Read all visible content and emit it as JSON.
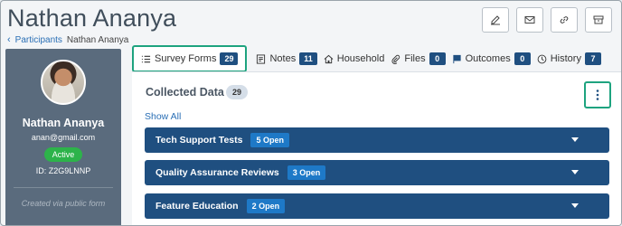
{
  "header": {
    "title": "Nathan Ananya",
    "breadcrumb": {
      "parent": "Participants",
      "current": "Nathan Ananya"
    },
    "actions": [
      {
        "icon": "edit-icon"
      },
      {
        "icon": "mail-icon"
      },
      {
        "icon": "link-icon"
      },
      {
        "icon": "archive-icon"
      }
    ]
  },
  "profile": {
    "name": "Nathan Ananya",
    "email": "anan@gmail.com",
    "status": "Active",
    "status_color": "#2db34a",
    "id_text": "ID: Z2G9LNNP",
    "note": "Created via public form"
  },
  "tabs": [
    {
      "label": "Survey Forms",
      "count": "29",
      "icon": "list-icon",
      "active": true
    },
    {
      "label": "Notes",
      "count": "11",
      "icon": "notes-icon"
    },
    {
      "label": "Household",
      "count": "",
      "icon": "home-icon"
    },
    {
      "label": "Files",
      "count": "0",
      "icon": "paperclip-icon"
    },
    {
      "label": "Outcomes",
      "count": "0",
      "icon": "flag-icon"
    },
    {
      "label": "History",
      "count": "7",
      "icon": "clock-icon"
    }
  ],
  "collected": {
    "title": "Collected Data",
    "count": "29",
    "show_all": "Show All",
    "groups": [
      {
        "title": "Tech Support Tests",
        "badge": "5 Open"
      },
      {
        "title": "Quality Assurance Reviews",
        "badge": "3 Open"
      },
      {
        "title": "Feature Education",
        "badge": "2 Open"
      }
    ]
  },
  "colors": {
    "accent": "#1f4f80",
    "highlight": "#1ea37f",
    "link": "#2a6fb5"
  }
}
